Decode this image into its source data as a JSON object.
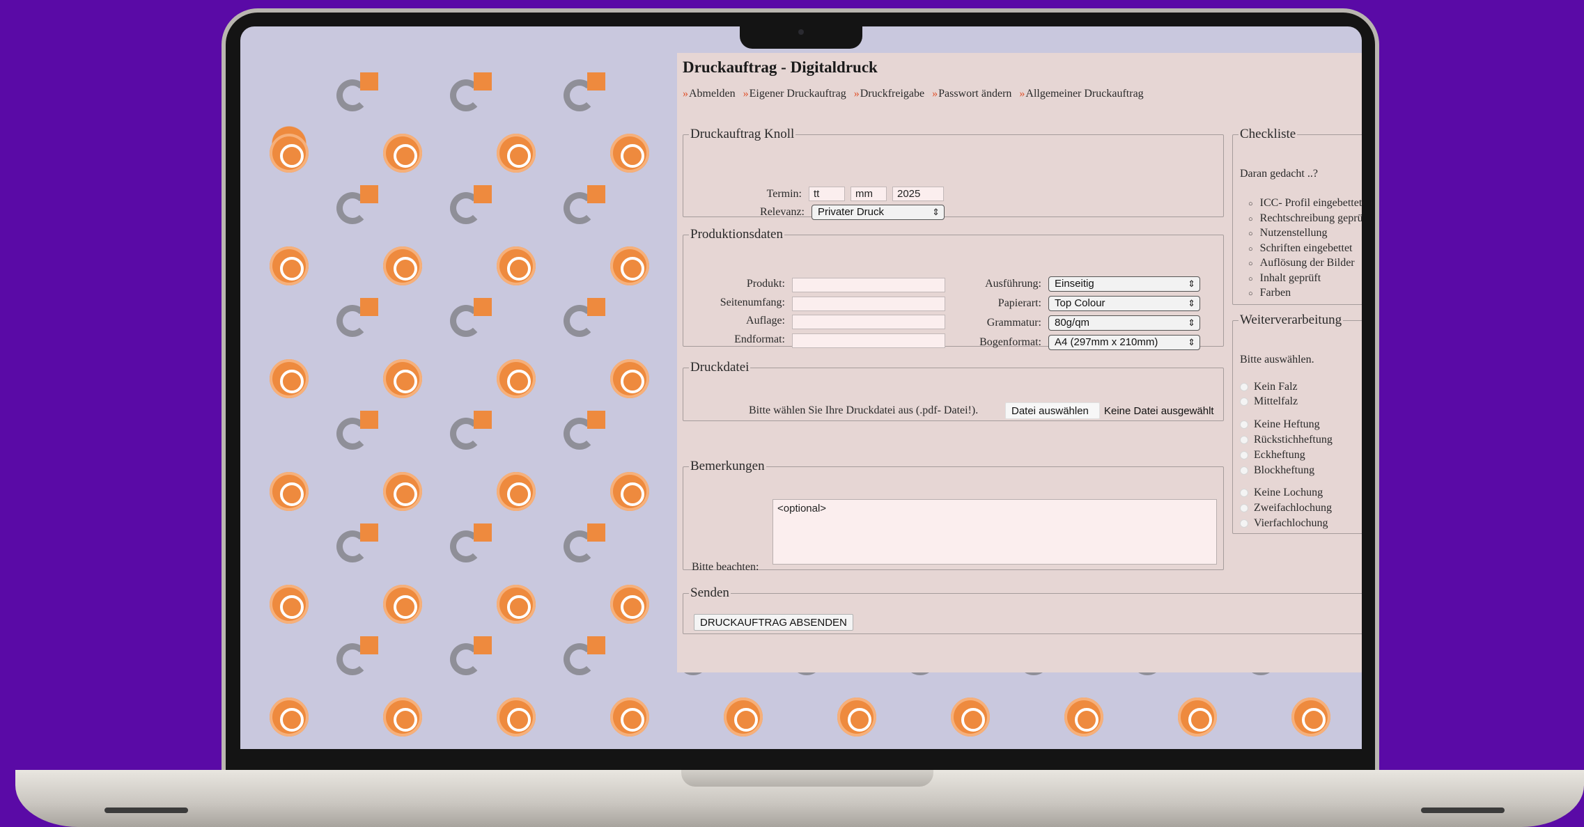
{
  "page": {
    "title": "Druckauftrag - Digitaldruck",
    "nav": [
      {
        "marker": "»",
        "label": "Abmelden"
      },
      {
        "marker": "»",
        "label": "Eigener Druckauftrag"
      },
      {
        "marker": "»",
        "label": "Druckfreigabe"
      },
      {
        "marker": "»",
        "label": "Passwort ändern"
      },
      {
        "marker": "»",
        "label": "Allgemeiner Druckauftrag"
      }
    ]
  },
  "auftrag": {
    "legend": "Druckauftrag Knoll",
    "termin_label": "Termin:",
    "termin_day": "tt",
    "termin_month": "mm",
    "termin_year": "2025",
    "relevanz_label": "Relevanz:",
    "relevanz_value": "Privater Druck"
  },
  "produktion": {
    "legend": "Produktionsdaten",
    "produkt_label": "Produkt:",
    "seitenumfang_label": "Seitenumfang:",
    "auflage_label": "Auflage:",
    "endformat_label": "Endformat:",
    "ausfuehrung_label": "Ausführung:",
    "ausfuehrung_value": "Einseitig",
    "papierart_label": "Papierart:",
    "papierart_value": "Top Colour",
    "grammatur_label": "Grammatur:",
    "grammatur_value": "80g/qm",
    "bogenformat_label": "Bogenformat:",
    "bogenformat_value": "A4 (297mm x 210mm)"
  },
  "datei": {
    "legend": "Druckdatei",
    "hint": "Bitte wählen Sie Ihre Druckdatei aus (.pdf- Datei!).",
    "button": "Datei auswählen",
    "status": "Keine Datei ausgewählt"
  },
  "bemerkungen": {
    "legend": "Bemerkungen",
    "label": "Bitte beachten:",
    "placeholder": "<optional>"
  },
  "senden": {
    "legend": "Senden",
    "button": "DRUCKAUFTRAG ABSENDEN"
  },
  "checkliste": {
    "legend": "Checkliste",
    "intro": "Daran gedacht ..?",
    "items": [
      "ICC- Profil eingebettet",
      "Rechtschreibung geprüft",
      "Nutzenstellung",
      "Schriften eingebettet",
      "Auflösung der Bilder",
      "Inhalt geprüft",
      "Farben"
    ]
  },
  "weiterverarbeitung": {
    "legend": "Weiterverarbeitung",
    "intro": "Bitte auswählen.",
    "falz": [
      "Kein Falz",
      "Mittelfalz"
    ],
    "heftung": [
      "Keine Heftung",
      "Rückstichheftung",
      "Eckheftung",
      "Blockheftung"
    ],
    "lochung": [
      "Keine Lochung",
      "Zweifachlochung",
      "Vierfachlochung"
    ]
  },
  "colors": {
    "background": "#5a0aa6",
    "page": "#e6d6d4",
    "accent_orange": "#ee8a3e",
    "nav_marker": "#e0502a"
  }
}
